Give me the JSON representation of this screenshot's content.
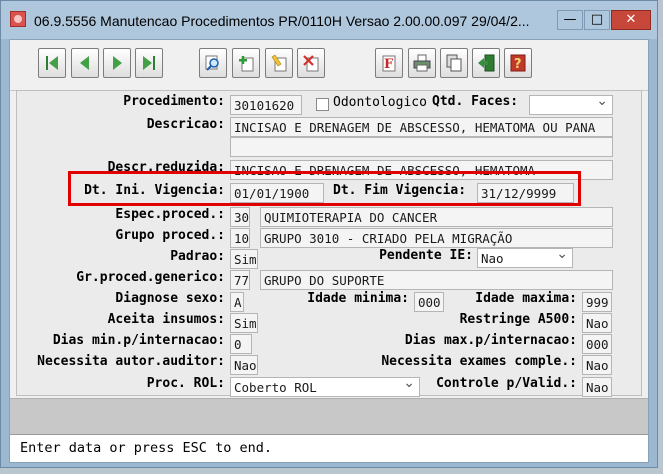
{
  "window": {
    "title": "06.9.5556 Manutencao  Procedimentos PR/0110H Versao 2.00.00.097 29/04/2...",
    "minimize": "—",
    "maximize": "□",
    "close": "✕"
  },
  "toolbar": {
    "buttons": [
      {
        "name": "first-record-button",
        "icon": "first-icon"
      },
      {
        "name": "previous-record-button",
        "icon": "previous-icon"
      },
      {
        "name": "next-record-button",
        "icon": "next-icon"
      },
      {
        "name": "last-record-button",
        "icon": "last-icon"
      },
      {
        "name": "goto-search-button",
        "icon": "magnifier-icon"
      },
      {
        "name": "add-record-button",
        "icon": "add-icon"
      },
      {
        "name": "edit-record-button",
        "icon": "pencil-icon"
      },
      {
        "name": "delete-record-button",
        "icon": "delete-icon"
      },
      {
        "name": "filter-button",
        "icon": "filter-icon"
      },
      {
        "name": "print-button",
        "icon": "printer-icon"
      },
      {
        "name": "copy-button",
        "icon": "copy-icon"
      },
      {
        "name": "exit-button",
        "icon": "exit-icon"
      },
      {
        "name": "help-button",
        "icon": "help-icon"
      }
    ]
  },
  "form": {
    "procedimento": {
      "label": "Procedimento:",
      "value": "30101620"
    },
    "odontologico": {
      "label": "Odontologico"
    },
    "qtd_faces": {
      "label": "Qtd. Faces:",
      "value": ""
    },
    "descricao": {
      "label": "Descricao:",
      "value": "INCISAO E DRENAGEM DE ABSCESSO, HEMATOMA OU PANA",
      "value2": ""
    },
    "descr_reduzida": {
      "label": "Descr.reduzida:",
      "value": "INCISAO E DRENAGEM DE ABSCESSO, HEMATOMA"
    },
    "dt_ini": {
      "label": "Dt. Ini. Vigencia:",
      "value": "01/01/1900"
    },
    "dt_fim": {
      "label": "Dt. Fim Vigencia:",
      "value": "31/12/9999"
    },
    "espec_proced": {
      "label": "Espec.proced.:",
      "code": "30",
      "desc": "QUIMIOTERAPIA DO CANCER"
    },
    "grupo_proced": {
      "label": "Grupo proced.:",
      "code": "10",
      "desc": "GRUPO 3010 - CRIADO PELA MIGRAÇÃO"
    },
    "padrao": {
      "label": "Padrao:",
      "value": "Sim"
    },
    "pendente_ie": {
      "label": "Pendente IE:",
      "value": "Nao"
    },
    "gr_proced_generico": {
      "label": "Gr.proced.generico:",
      "code": "77",
      "desc": "GRUPO DO SUPORTE"
    },
    "diagnose_sexo": {
      "label": "Diagnose sexo:",
      "value": "A"
    },
    "idade_minima": {
      "label": "Idade minima:",
      "value": "000"
    },
    "idade_maxima": {
      "label": "Idade maxima:",
      "value": "999"
    },
    "aceita_insumos": {
      "label": "Aceita insumos:",
      "value": "Sim"
    },
    "restringe_a500": {
      "label": "Restringe A500:",
      "value": "Nao"
    },
    "dias_min": {
      "label": "Dias min.p/internacao:",
      "value": "0"
    },
    "dias_max": {
      "label": "Dias max.p/internacao:",
      "value": "000"
    },
    "necessita_autor": {
      "label": "Necessita autor.auditor:",
      "value": "Nao"
    },
    "necessita_exames": {
      "label": "Necessita exames comple.:",
      "value": "Nao"
    },
    "proc_rol": {
      "label": "Proc. ROL:",
      "value": "Coberto ROL"
    },
    "controle_valid": {
      "label": "Controle p/Valid.:",
      "value": "Nao"
    }
  },
  "status": {
    "message": "Enter data or press ESC to end."
  },
  "colors": {
    "highlight": "#e00000",
    "titlebar": "#aec7dd",
    "close": "#c7483b"
  }
}
